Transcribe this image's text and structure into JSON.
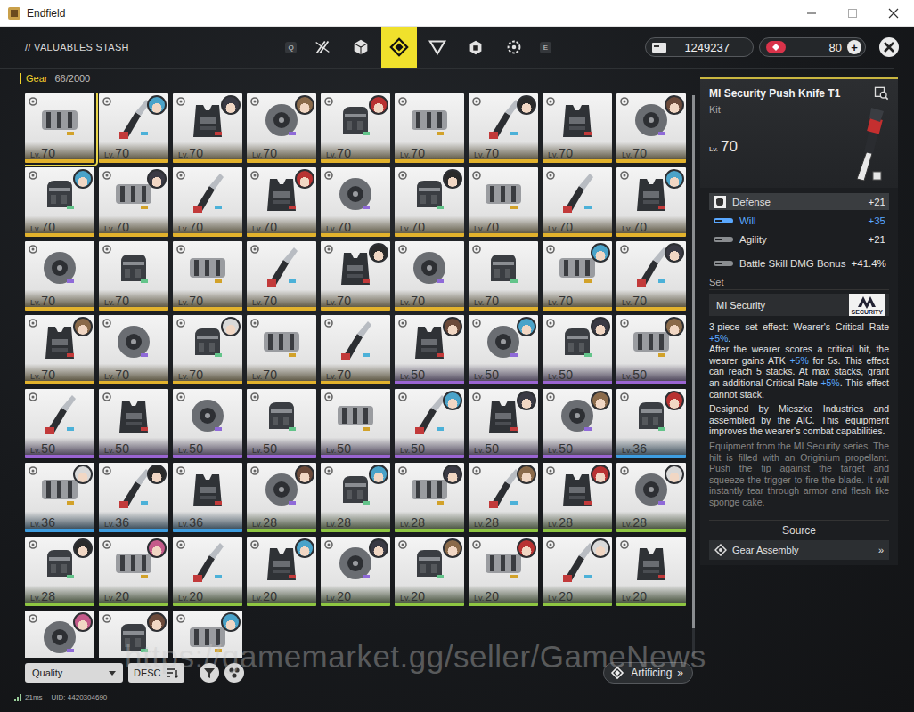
{
  "window": {
    "title": "Endfield"
  },
  "header": {
    "title": "// VALUABLES STASH",
    "key_prev": "Q",
    "key_next": "E",
    "tabs": [
      {
        "selected": false
      },
      {
        "selected": false
      },
      {
        "selected": true
      },
      {
        "selected": false
      },
      {
        "selected": false
      },
      {
        "selected": false
      }
    ],
    "currencies": [
      {
        "value": "1249237",
        "addable": false
      },
      {
        "value": "80",
        "addable": true,
        "plus": "+"
      }
    ]
  },
  "category": {
    "label": "Gear",
    "count": "66/2000"
  },
  "grid": {
    "level_prefix": "Lv.",
    "scroll": {
      "level": 0.95
    },
    "items": [
      {
        "level": "70",
        "color": "#e2b22c",
        "equipped": false,
        "selected": true
      },
      {
        "level": "70",
        "color": "#e2b22c",
        "equipped": true,
        "selected": false
      },
      {
        "level": "70",
        "color": "#e2b22c",
        "equipped": true,
        "selected": false
      },
      {
        "level": "70",
        "color": "#e2b22c",
        "equipped": true,
        "selected": false
      },
      {
        "level": "70",
        "color": "#e2b22c",
        "equipped": true,
        "selected": false
      },
      {
        "level": "70",
        "color": "#e2b22c",
        "equipped": false,
        "selected": false
      },
      {
        "level": "70",
        "color": "#e2b22c",
        "equipped": true,
        "selected": false
      },
      {
        "level": "70",
        "color": "#e2b22c",
        "equipped": false,
        "selected": false
      },
      {
        "level": "70",
        "color": "#e2b22c",
        "equipped": true,
        "selected": false
      },
      {
        "level": "70",
        "color": "#e2b22c",
        "equipped": true,
        "selected": false
      },
      {
        "level": "70",
        "color": "#e2b22c",
        "equipped": true,
        "selected": false
      },
      {
        "level": "70",
        "color": "#e2b22c",
        "equipped": false,
        "selected": false
      },
      {
        "level": "70",
        "color": "#e2b22c",
        "equipped": true,
        "selected": false
      },
      {
        "level": "70",
        "color": "#e2b22c",
        "equipped": false,
        "selected": false
      },
      {
        "level": "70",
        "color": "#e2b22c",
        "equipped": true,
        "selected": false
      },
      {
        "level": "70",
        "color": "#e2b22c",
        "equipped": false,
        "selected": false
      },
      {
        "level": "70",
        "color": "#e2b22c",
        "equipped": false,
        "selected": false
      },
      {
        "level": "70",
        "color": "#e2b22c",
        "equipped": true,
        "selected": false
      },
      {
        "level": "70",
        "color": "#e2b22c",
        "equipped": false,
        "selected": false
      },
      {
        "level": "70",
        "color": "#e2b22c",
        "equipped": false,
        "selected": false
      },
      {
        "level": "70",
        "color": "#e2b22c",
        "equipped": false,
        "selected": false
      },
      {
        "level": "70",
        "color": "#e2b22c",
        "equipped": false,
        "selected": false
      },
      {
        "level": "70",
        "color": "#e2b22c",
        "equipped": true,
        "selected": false
      },
      {
        "level": "70",
        "color": "#e2b22c",
        "equipped": false,
        "selected": false
      },
      {
        "level": "70",
        "color": "#e2b22c",
        "equipped": false,
        "selected": false
      },
      {
        "level": "70",
        "color": "#e2b22c",
        "equipped": true,
        "selected": false
      },
      {
        "level": "70",
        "color": "#e2b22c",
        "equipped": true,
        "selected": false
      },
      {
        "level": "70",
        "color": "#e2b22c",
        "equipped": true,
        "selected": false
      },
      {
        "level": "70",
        "color": "#e2b22c",
        "equipped": false,
        "selected": false
      },
      {
        "level": "70",
        "color": "#e2b22c",
        "equipped": true,
        "selected": false
      },
      {
        "level": "70",
        "color": "#e2b22c",
        "equipped": false,
        "selected": false
      },
      {
        "level": "70",
        "color": "#e2b22c",
        "equipped": false,
        "selected": false
      },
      {
        "level": "50",
        "color": "#9a64d2",
        "equipped": true,
        "selected": false
      },
      {
        "level": "50",
        "color": "#9a64d2",
        "equipped": true,
        "selected": false
      },
      {
        "level": "50",
        "color": "#9a64d2",
        "equipped": true,
        "selected": false
      },
      {
        "level": "50",
        "color": "#9a64d2",
        "equipped": true,
        "selected": false
      },
      {
        "level": "50",
        "color": "#9a64d2",
        "equipped": false,
        "selected": false
      },
      {
        "level": "50",
        "color": "#9a64d2",
        "equipped": false,
        "selected": false
      },
      {
        "level": "50",
        "color": "#9a64d2",
        "equipped": false,
        "selected": false
      },
      {
        "level": "50",
        "color": "#9a64d2",
        "equipped": false,
        "selected": false
      },
      {
        "level": "50",
        "color": "#9a64d2",
        "equipped": false,
        "selected": false
      },
      {
        "level": "50",
        "color": "#9a64d2",
        "equipped": true,
        "selected": false
      },
      {
        "level": "50",
        "color": "#9a64d2",
        "equipped": true,
        "selected": false
      },
      {
        "level": "50",
        "color": "#9a64d2",
        "equipped": true,
        "selected": false
      },
      {
        "level": "36",
        "color": "#3d9de0",
        "equipped": true,
        "selected": false
      },
      {
        "level": "36",
        "color": "#3d9de0",
        "equipped": true,
        "selected": false
      },
      {
        "level": "36",
        "color": "#3d9de0",
        "equipped": true,
        "selected": false
      },
      {
        "level": "36",
        "color": "#3d9de0",
        "equipped": false,
        "selected": false
      },
      {
        "level": "28",
        "color": "#8ec641",
        "equipped": true,
        "selected": false
      },
      {
        "level": "28",
        "color": "#8ec641",
        "equipped": true,
        "selected": false
      },
      {
        "level": "28",
        "color": "#8ec641",
        "equipped": true,
        "selected": false
      },
      {
        "level": "28",
        "color": "#8ec641",
        "equipped": true,
        "selected": false
      },
      {
        "level": "28",
        "color": "#8ec641",
        "equipped": true,
        "selected": false
      },
      {
        "level": "28",
        "color": "#8ec641",
        "equipped": true,
        "selected": false
      },
      {
        "level": "28",
        "color": "#8ec641",
        "equipped": true,
        "selected": false
      },
      {
        "level": "20",
        "color": "#8ec641",
        "equipped": true,
        "selected": false
      },
      {
        "level": "20",
        "color": "#8ec641",
        "equipped": false,
        "selected": false
      },
      {
        "level": "20",
        "color": "#8ec641",
        "equipped": true,
        "selected": false
      },
      {
        "level": "20",
        "color": "#8ec641",
        "equipped": true,
        "selected": false
      },
      {
        "level": "20",
        "color": "#8ec641",
        "equipped": true,
        "selected": false
      },
      {
        "level": "20",
        "color": "#8ec641",
        "equipped": true,
        "selected": false
      },
      {
        "level": "20",
        "color": "#8ec641",
        "equipped": true,
        "selected": false
      },
      {
        "level": "20",
        "color": "#8ec641",
        "equipped": false,
        "selected": false
      },
      {
        "color": "#8ec641",
        "equipped": true,
        "selected": false
      },
      {
        "color": "#8ec641",
        "equipped": true,
        "selected": false
      },
      {
        "color": "#8ec641",
        "equipped": true,
        "selected": false
      }
    ]
  },
  "detail": {
    "name": "MI Security Push Knife T1",
    "type": "Kit",
    "level_prefix": "Lv.",
    "level": "70",
    "stats": [
      {
        "kind": "main",
        "label": "Defense",
        "value": "+21",
        "highlighted": false
      },
      {
        "kind": "sub",
        "label": "Will",
        "value": "+35",
        "highlighted": true
      },
      {
        "kind": "sub",
        "label": "Agility",
        "value": "+21",
        "highlighted": false
      },
      {
        "kind": "bonus",
        "label": "Battle Skill DMG Bonus",
        "value": "+41.4%",
        "highlighted": false
      }
    ],
    "set_heading": "Set",
    "set_name": "MI Security",
    "set_logo_text": "SECURITY",
    "set_effect": [
      [
        {
          "text": "3-piece set effect: Wearer's Critical Rate ",
          "highlighted": false
        },
        {
          "text": "+5%",
          "highlighted": true
        },
        {
          "text": ".",
          "highlighted": false
        }
      ],
      [
        {
          "text": "After the wearer scores a critical hit, the wearer gains ATK ",
          "highlighted": false
        },
        {
          "text": "+5%",
          "highlighted": true
        },
        {
          "text": " for 5s. This effect can reach 5 stacks. At max stacks, grant an additional Critical Rate ",
          "highlighted": false
        },
        {
          "text": "+5%",
          "highlighted": true
        },
        {
          "text": ". This effect cannot stack.",
          "highlighted": false
        }
      ]
    ],
    "description": "Designed by Mieszko Industries and assembled by the AIC. This equipment improves the wearer's combat capabilities.",
    "lore": "Equipment from the MI Security series. The hilt is filled with an Originium propellant. Push the tip against the target and squeeze the trigger to fire the blade. It will instantly tear through armor and flesh like sponge cake.",
    "source_heading": "Source",
    "sources": [
      {
        "label": "Gear Assembly",
        "arrow": "»"
      }
    ]
  },
  "toolbar": {
    "sort": {
      "label": "Quality"
    },
    "order": {
      "label": "DESC"
    },
    "artificing": {
      "label": "Artificing",
      "arrow": "»"
    }
  },
  "status": {
    "ping": "21ms",
    "uid": "UID: 4420304690"
  },
  "watermark": "https://gamemarket.gg/seller/GameNews"
}
